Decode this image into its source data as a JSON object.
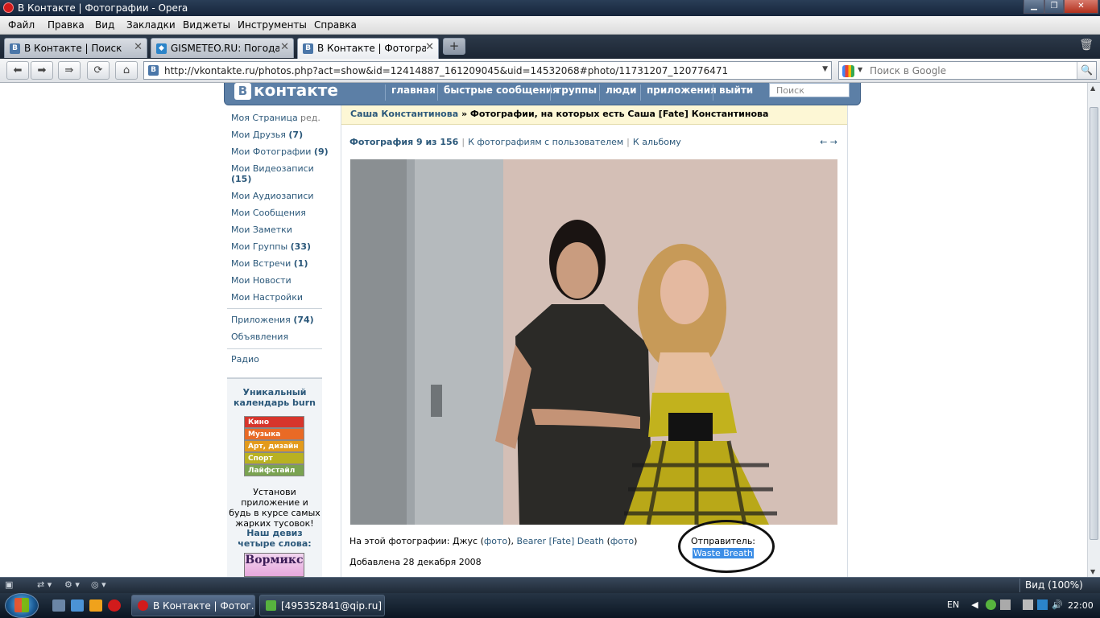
{
  "window": {
    "title": "В Контакте | Фотографии - Opera",
    "btn_min": "▁",
    "btn_max": "❐",
    "btn_close": "✕"
  },
  "menu": [
    "Файл",
    "Правка",
    "Вид",
    "Закладки",
    "Виджеты",
    "Инструменты",
    "Справка"
  ],
  "tabs": [
    {
      "label": "В Контакте | Поиск",
      "icon": "В"
    },
    {
      "label": "GISMETEO.RU: Погода...",
      "icon": "◆"
    },
    {
      "label": "В Контакте | Фотогра...",
      "icon": "В"
    }
  ],
  "tab_close": "✕",
  "newtab": "+",
  "nav": {
    "url": "http://vkontakte.ru/photos.php?act=show&id=12414887_161209045&uid=14532068#photo/11731207_120776471",
    "search_placeholder": "Поиск в Google",
    "back": "⬅",
    "forward": "➡",
    "fastforward": "⇛",
    "reload": "⟳",
    "home": "⌂",
    "dropdown": "▼",
    "site_icon": "В",
    "mag": "🔍"
  },
  "vk": {
    "logo_b": "B",
    "logo_text": "контакте",
    "nav": [
      "главная",
      "быстрые сообщения",
      "группы",
      "люди",
      "приложения",
      "выйти"
    ],
    "search_placeholder": "Поиск"
  },
  "left_menu": [
    {
      "label": "Моя Страница",
      "count": "",
      "extra": "ред."
    },
    {
      "label": "Мои Друзья",
      "count": "(7)"
    },
    {
      "label": "Мои Фотографии",
      "count": "(9)"
    },
    {
      "label": "Мои Видеозаписи",
      "count": "(15)"
    },
    {
      "label": "Мои Аудиозаписи",
      "count": ""
    },
    {
      "label": "Мои Сообщения",
      "count": ""
    },
    {
      "label": "Мои Заметки",
      "count": ""
    },
    {
      "label": "Мои Группы",
      "count": "(33)"
    },
    {
      "label": "Мои Встречи",
      "count": "(1)"
    },
    {
      "label": "Мои Новости",
      "count": ""
    },
    {
      "label": "Мои Настройки",
      "count": ""
    }
  ],
  "left_menu2": [
    {
      "label": "Приложения",
      "count": "(74)"
    },
    {
      "label": "Объявления",
      "count": ""
    }
  ],
  "left_menu3": [
    {
      "label": "Радио"
    }
  ],
  "ad1": {
    "title": "Уникальный календарь burn",
    "stripes": [
      {
        "label": "Кино",
        "color": "#d7352c"
      },
      {
        "label": "Музыка",
        "color": "#e96a25"
      },
      {
        "label": "Арт, дизайн",
        "color": "#e39a1b"
      },
      {
        "label": "Спорт",
        "color": "#b9b121"
      },
      {
        "label": "Лайфстайл",
        "color": "#7aa351"
      }
    ],
    "text": "Установи приложение и будь в курсе самых жарких тусовок!"
  },
  "ad2": {
    "title": "Наш девиз четыре слова:",
    "image_text": "Вормикс"
  },
  "photo_page": {
    "crumb_user": "Саша Константинова",
    "crumb_rest": "» Фотографии, на которых есть Саша [Fate] Константинова",
    "counter": "Фотография 9 из 156",
    "link_user_photos": "К фотографиям с пользователем",
    "link_album": "К альбому",
    "sep": "|",
    "prev": "←",
    "next": "→",
    "in_photo_label": "На этой фотографии: Джус",
    "paren_open": "(",
    "paren_close": ")",
    "photo_link": "фото",
    "comma": ",",
    "person2": "Bearer [Fate] Death",
    "added": "Добавлена 28 декабря 2008",
    "sender_label": "Отправитель:",
    "sender_name": "Waste Breath"
  },
  "statusbar": {
    "zoom": "Вид (100%)"
  },
  "taskbar": {
    "tasks": [
      {
        "label": "В Контакте | Фотог...",
        "color": "#d21b1b"
      },
      {
        "label": "[495352841@qip.ru] ...",
        "color": "#57b33e"
      }
    ],
    "lang": "EN",
    "time": "22:00",
    "tray_arrow": "◀",
    "tray_speaker": "🔊"
  }
}
